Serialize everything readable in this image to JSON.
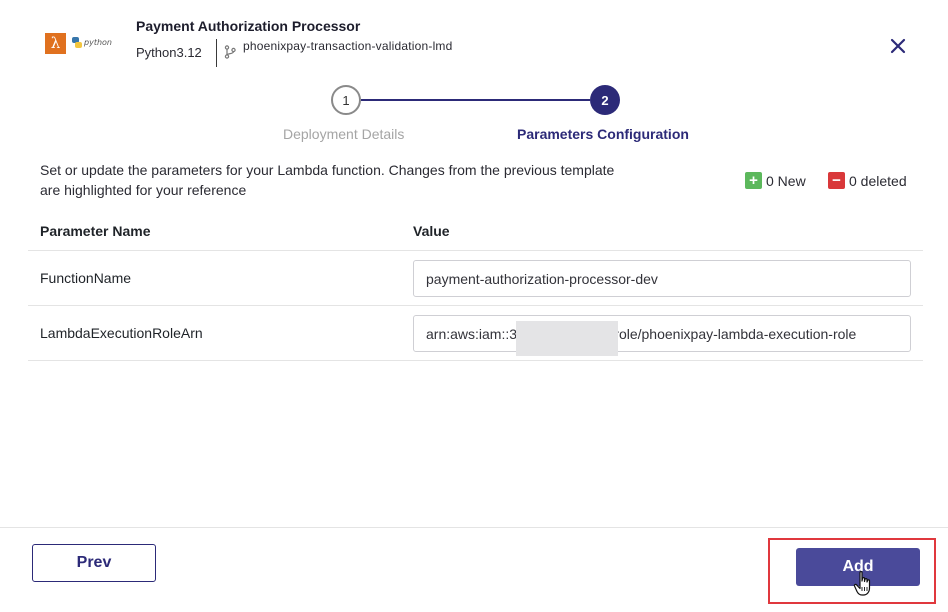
{
  "header": {
    "title": "Payment Authorization Processor",
    "runtime": "Python3.12",
    "repository": "phoenixpay-transaction-validation-lmd",
    "python_logo_text": "python",
    "lambda_icon": "lambda-icon",
    "branch_icon": "branch-icon",
    "close_icon": "close-icon"
  },
  "stepper": {
    "steps": [
      {
        "number": "1",
        "label": "Deployment Details",
        "state": "completed"
      },
      {
        "number": "2",
        "label": "Parameters Configuration",
        "state": "active"
      }
    ]
  },
  "description": "Set or update the parameters for your Lambda function. Changes from the previous template are highlighted for your reference",
  "legend": {
    "new_label": "0 New",
    "deleted_label": "0 deleted",
    "new_color": "#5cb85c",
    "deleted_color": "#d9383a"
  },
  "table": {
    "columns": [
      "Parameter Name",
      "Value"
    ],
    "rows": [
      {
        "name": "FunctionName",
        "value": "payment-authorization-processor-dev"
      },
      {
        "name": "LambdaExecutionRoleArn",
        "value": "arn:aws:iam::3                         role/phoenixpay-lambda-execution-role"
      }
    ]
  },
  "footer": {
    "prev_label": "Prev",
    "add_label": "Add"
  },
  "colors": {
    "accent": "#2c2a78",
    "add_button": "#4a4a9a",
    "highlight": "#e0383d"
  }
}
